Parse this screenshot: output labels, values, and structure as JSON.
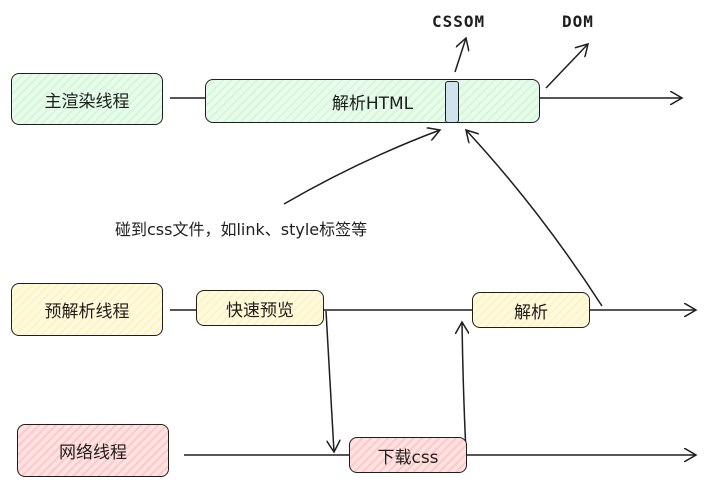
{
  "threads": {
    "main": "主渲染线程",
    "preparse": "预解析线程",
    "network": "网络线程"
  },
  "tasks": {
    "parse_html": "解析HTML",
    "quick_preview": "快速预览",
    "parse": "解析",
    "download_css": "下载css"
  },
  "outputs": {
    "cssom": "CSSOM",
    "dom": "DOM"
  },
  "annotation": "碰到css文件，如link、style标签等",
  "colors": {
    "green": "#d3f9d8",
    "yellow": "#fff3bf",
    "pink": "#ffc9c9",
    "stroke": "#1e1e1e"
  }
}
